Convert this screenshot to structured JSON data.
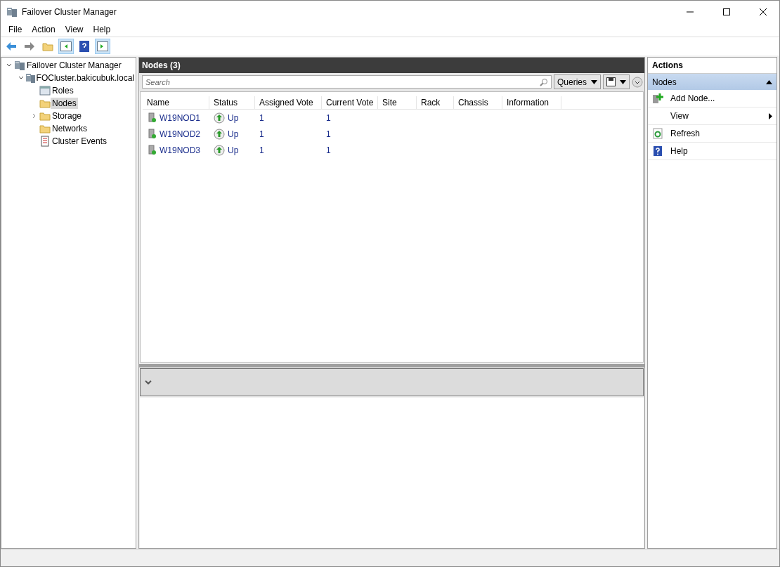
{
  "window": {
    "title": "Failover Cluster Manager"
  },
  "menu": [
    "File",
    "Action",
    "View",
    "Help"
  ],
  "tree": [
    {
      "label": "Failover Cluster Manager",
      "kind": "cluster",
      "expanded": true,
      "selected": false,
      "children": [
        {
          "label": "FOCluster.bakicubuk.local",
          "kind": "cluster",
          "expanded": true,
          "selected": false,
          "children": [
            {
              "label": "Roles",
              "kind": "roles",
              "selected": false
            },
            {
              "label": "Nodes",
              "kind": "folder",
              "selected": true
            },
            {
              "label": "Storage",
              "kind": "folder",
              "expanded": false,
              "selected": false
            },
            {
              "label": "Networks",
              "kind": "folder",
              "selected": false
            },
            {
              "label": "Cluster Events",
              "kind": "events",
              "selected": false
            }
          ]
        }
      ]
    }
  ],
  "center": {
    "title": "Nodes (3)",
    "search": {
      "placeholder": "Search"
    },
    "queries": "Queries",
    "table": {
      "columns": [
        "Name",
        "Status",
        "Assigned Vote",
        "Current Vote",
        "Site",
        "Rack",
        "Chassis",
        "Information"
      ],
      "rows": [
        {
          "name": "W19NOD1",
          "status": "Up",
          "assigned_vote": "1",
          "current_vote": "1"
        },
        {
          "name": "W19NOD2",
          "status": "Up",
          "assigned_vote": "1",
          "current_vote": "1"
        },
        {
          "name": "W19NOD3",
          "status": "Up",
          "assigned_vote": "1",
          "current_vote": "1"
        }
      ]
    }
  },
  "actions": {
    "title": "Actions",
    "section": "Nodes",
    "items": [
      {
        "label": "Add Node...",
        "kind": "add"
      },
      {
        "label": "View",
        "kind": "submenu"
      },
      {
        "label": "Refresh",
        "kind": "refresh"
      },
      {
        "label": "Help",
        "kind": "help"
      }
    ]
  }
}
